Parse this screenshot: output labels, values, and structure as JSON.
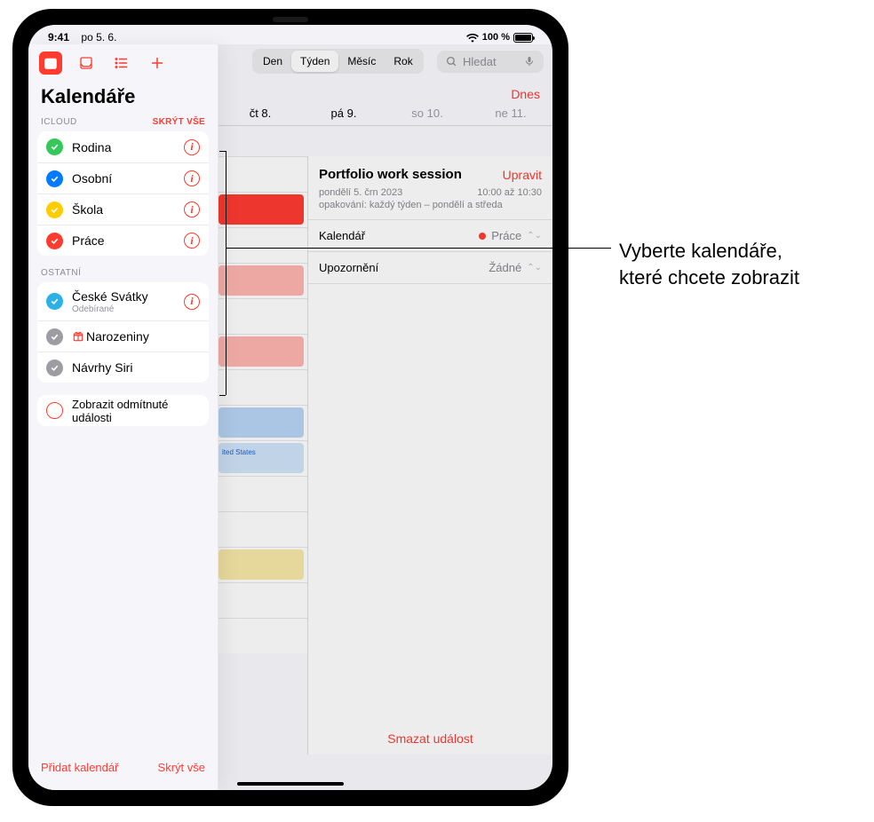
{
  "status": {
    "time": "9:41",
    "date": "po 5. 6.",
    "battery": "100 %"
  },
  "sidebar": {
    "title": "Kalendáře",
    "sections": [
      {
        "label": "ICLOUD",
        "action": "SKRÝT VŠE",
        "items": [
          {
            "name": "Rodina",
            "color": "#34c759",
            "checked": true,
            "has_info": true
          },
          {
            "name": "Osobní",
            "color": "#007aff",
            "checked": true,
            "has_info": true
          },
          {
            "name": "Škola",
            "color": "#ffcc00",
            "checked": true,
            "has_info": true
          },
          {
            "name": "Práce",
            "color": "#ff3b30",
            "checked": true,
            "has_info": true
          }
        ]
      },
      {
        "label": "OSTATNÍ",
        "action": "",
        "items": [
          {
            "name": "České Svátky",
            "sub": "Odebírané",
            "color": "#2bb1e6",
            "checked": true,
            "has_info": true
          },
          {
            "name": "Narozeniny",
            "color": "#9d9ca3",
            "checked": true,
            "birthday_icon": true
          },
          {
            "name": "Návrhy Siri",
            "color": "#9d9ca3",
            "checked": true
          }
        ]
      }
    ],
    "declined_events_label": "Zobrazit odmítnuté události",
    "footer": {
      "add": "Přidat kalendář",
      "hide_all": "Skrýt vše"
    }
  },
  "main": {
    "view_tabs": [
      "Den",
      "Týden",
      "Měsíc",
      "Rok"
    ],
    "view_selected": "Týden",
    "search_placeholder": "Hledat",
    "today_label": "Dnes",
    "day_headers": [
      {
        "label": "čt 8.",
        "dim": false
      },
      {
        "label": "pá 9.",
        "dim": false
      },
      {
        "label": "so 10.",
        "dim": true
      },
      {
        "label": "ne 11.",
        "dim": true
      }
    ],
    "grid_snippet": "ited States",
    "event": {
      "title": "Portfolio work session",
      "edit": "Upravit",
      "date": "pondělí 5. črn 2023",
      "time": "10:00 až 10:30",
      "repeat": "opakování: každý týden – pondělí a středa",
      "calendar_label": "Kalendář",
      "calendar_value": "Práce",
      "alert_label": "Upozornění",
      "alert_value": "Žádné",
      "delete": "Smazat událost"
    }
  },
  "callout": {
    "line1": "Vyberte kalendáře,",
    "line2": "které chcete zobrazit"
  }
}
